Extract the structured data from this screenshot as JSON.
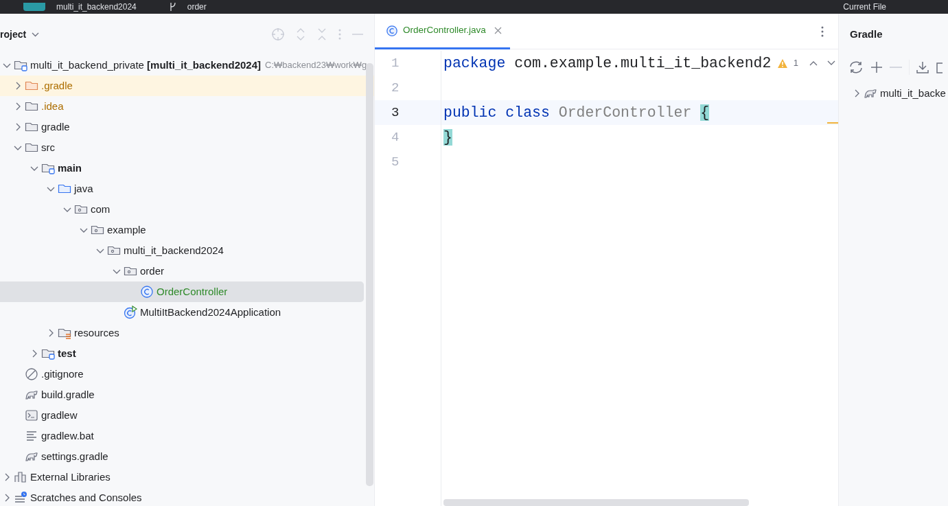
{
  "title_bar": {
    "project": "multi_it_backend2024",
    "branch": "order",
    "run_config": "Current File"
  },
  "project_panel": {
    "title": "roject",
    "tree": [
      {
        "label": "multi_it_backend_private **[multi_it_backend2024]**",
        "path": "C:₩backend23₩work₩g",
        "kind": "module",
        "color": "#1e1f22",
        "expanded": true,
        "selected": false,
        "highlighted": false,
        "children": [
          {
            "label": ".gradle",
            "kind": "folder-ignored",
            "color": "#ad6e00",
            "expanded": false,
            "selected": false,
            "highlighted": true
          },
          {
            "label": ".idea",
            "kind": "folder",
            "color": "#ad6e00",
            "expanded": false,
            "selected": false,
            "highlighted": false
          },
          {
            "label": "gradle",
            "kind": "folder",
            "color": "#1e1f22",
            "expanded": false,
            "selected": false,
            "highlighted": false
          },
          {
            "label": "src",
            "kind": "folder",
            "color": "#1e1f22",
            "expanded": true,
            "selected": false,
            "highlighted": false,
            "children": [
              {
                "label": "main",
                "kind": "source-set",
                "color": "#1e1f22",
                "expanded": true,
                "selected": false,
                "highlighted": false,
                "children": [
                  {
                    "label": "java",
                    "kind": "source-root",
                    "color": "#1e1f22",
                    "expanded": true,
                    "selected": false,
                    "highlighted": false,
                    "children": [
                      {
                        "label": "com",
                        "kind": "package",
                        "color": "#1e1f22",
                        "expanded": true,
                        "selected": false,
                        "highlighted": false,
                        "children": [
                          {
                            "label": "example",
                            "kind": "package",
                            "color": "#1e1f22",
                            "expanded": true,
                            "selected": false,
                            "highlighted": false,
                            "children": [
                              {
                                "label": "multi_it_backend2024",
                                "kind": "package",
                                "color": "#1e1f22",
                                "expanded": true,
                                "selected": false,
                                "highlighted": false,
                                "children": [
                                  {
                                    "label": "order",
                                    "kind": "package",
                                    "color": "#1e1f22",
                                    "expanded": true,
                                    "selected": false,
                                    "highlighted": false,
                                    "children": [
                                      {
                                        "label": "OrderController",
                                        "kind": "class",
                                        "color": "#2f8a2a",
                                        "selected": true,
                                        "highlighted": false
                                      }
                                    ]
                                  },
                                  {
                                    "label": "MultiItBackend2024Application",
                                    "kind": "app-class",
                                    "color": "#1e1f22",
                                    "selected": false,
                                    "highlighted": false
                                  }
                                ]
                              }
                            ]
                          }
                        ]
                      }
                    ]
                  },
                  {
                    "label": "resources",
                    "kind": "resources",
                    "color": "#1e1f22",
                    "expanded": false,
                    "selected": false,
                    "highlighted": false
                  }
                ]
              },
              {
                "label": "test",
                "kind": "source-set",
                "color": "#1e1f22",
                "expanded": false,
                "selected": false,
                "highlighted": false
              }
            ]
          },
          {
            "label": ".gitignore",
            "kind": "gitignore",
            "color": "#1e1f22",
            "selected": false,
            "highlighted": false
          },
          {
            "label": "build.gradle",
            "kind": "gradle",
            "color": "#1e1f22",
            "selected": false,
            "highlighted": false
          },
          {
            "label": "gradlew",
            "kind": "terminal",
            "color": "#1e1f22",
            "selected": false,
            "highlighted": false
          },
          {
            "label": "gradlew.bat",
            "kind": "text",
            "color": "#1e1f22",
            "selected": false,
            "highlighted": false
          },
          {
            "label": "settings.gradle",
            "kind": "gradle",
            "color": "#1e1f22",
            "selected": false,
            "highlighted": false
          }
        ]
      },
      {
        "label": "External Libraries",
        "kind": "libraries",
        "color": "#1e1f22",
        "expanded": false,
        "selected": false,
        "highlighted": false
      },
      {
        "label": "Scratches and Consoles",
        "kind": "scratches",
        "color": "#1e1f22",
        "expanded": false,
        "selected": false,
        "highlighted": false
      }
    ]
  },
  "editor": {
    "tabs": [
      {
        "label": "OrderController.java",
        "selected": true
      }
    ],
    "warnings": "1",
    "lines": [
      {
        "number": "1",
        "current": false,
        "tokens": [
          {
            "text": "package",
            "kind": "keyword"
          },
          {
            "text": "com.example.multi_it_backend2",
            "kind": "plain"
          }
        ]
      },
      {
        "number": "2",
        "current": false
      },
      {
        "number": "3",
        "current": true,
        "tokens": [
          {
            "text": "public",
            "kind": "keyword"
          },
          {
            "text": "class",
            "kind": "keyword"
          },
          {
            "text": "OrderController",
            "kind": "unused"
          },
          {
            "text": "{",
            "kind": "brace-match"
          }
        ]
      },
      {
        "number": "4",
        "current": false,
        "tokens": [
          {
            "text": "}",
            "kind": "brace-match"
          }
        ]
      },
      {
        "number": "5",
        "current": false
      }
    ]
  },
  "gradle_panel": {
    "title": "Gradle",
    "tree": [
      {
        "label": "multi_it_backe",
        "expanded": false
      }
    ]
  }
}
